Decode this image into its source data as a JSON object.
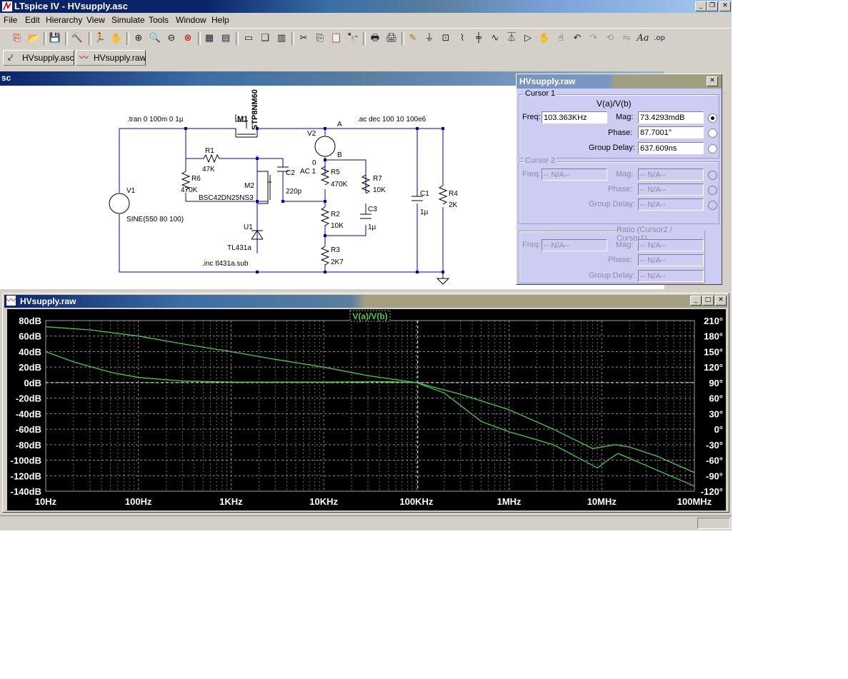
{
  "app": {
    "title": "LTspice IV - HVsupply.asc"
  },
  "menu": [
    "File",
    "Edit",
    "Hierarchy",
    "View",
    "Simulate",
    "Tools",
    "Window",
    "Help"
  ],
  "tabs": [
    {
      "label": "HVsupply.asc",
      "icon": "schematic-icon"
    },
    {
      "label": "HVsupply.raw",
      "icon": "waveform-icon"
    }
  ],
  "schematic": {
    "window_title": "sc",
    "directives": [
      ".tran 0 100m 0 1µ",
      ".ac dec 100 10 100e6",
      ".inc tl431a.sub"
    ],
    "components": {
      "m1_name": "M1",
      "m1_value": "STP8NM60",
      "m2_name": "M2",
      "m2_value": "BSC42DN25NS3",
      "r1_name": "R1",
      "r1_value": "47K",
      "r6_name": "R6",
      "r6_value": "470K",
      "c2_name": "C2",
      "c2_value": "220p",
      "v1_name": "V1",
      "v1_value": "SINE(550 80 100)",
      "v2_name": "V2",
      "v2_value": "AC 1",
      "v2_dc": "0",
      "r5_name": "R5",
      "r5_value": "470K",
      "r7_name": "R7",
      "r7_value": "10K",
      "c3_name": "C3",
      "c3_value": "1µ",
      "r2_name": "R2",
      "r2_value": "10K",
      "r3_name": "R3",
      "r3_value": "2K7",
      "u1_name": "U1",
      "u1_value": "TL431a",
      "c1_name": "C1",
      "c1_value": "1µ",
      "r4_name": "R4",
      "r4_value": "2K",
      "node_a": "A",
      "node_b": "B"
    }
  },
  "cursor_dialog": {
    "title": "HVsupply.raw",
    "cursor1": {
      "label": "Cursor 1",
      "trace": "V(a)/V(b)",
      "freq_label": "Freq:",
      "freq": "103.363KHz",
      "mag_label": "Mag:",
      "mag": "73.4293mdB",
      "phase_label": "Phase:",
      "phase": "87.7001°",
      "gd_label": "Group Delay:",
      "gd": "637.609ns"
    },
    "cursor2": {
      "label": "Cursor 2",
      "freq_label": "Freq:",
      "freq": "-- N/A--",
      "mag_label": "Mag:",
      "mag": "-- N/A--",
      "phase_label": "Phase:",
      "phase": "-- N/A--",
      "gd_label": "Group Delay:",
      "gd": "-- N/A--"
    },
    "ratio": {
      "label": "Ratio (Cursor2 / Cursor1)",
      "freq_label": "Freq:",
      "freq": "-- N/A--",
      "mag_label": "Mag:",
      "mag": "-- N/A--",
      "phase_label": "Phase:",
      "phase": "-- N/A--",
      "gd_label": "Group Delay:",
      "gd": "-- N/A--"
    }
  },
  "plot_window": {
    "title": "HVsupply.raw"
  },
  "chart_data": {
    "type": "line",
    "trace_label": "V(a)/V(b)",
    "x_scale": "log",
    "xlim": [
      10,
      100000000
    ],
    "x_ticks": [
      {
        "v": 10,
        "label": "10Hz"
      },
      {
        "v": 100,
        "label": "100Hz"
      },
      {
        "v": 1000,
        "label": "1KHz"
      },
      {
        "v": 10000,
        "label": "10KHz"
      },
      {
        "v": 100000,
        "label": "100KHz"
      },
      {
        "v": 1000000,
        "label": "1MHz"
      },
      {
        "v": 10000000,
        "label": "10MHz"
      },
      {
        "v": 100000000,
        "label": "100MHz"
      }
    ],
    "ylim_left": [
      -140,
      80
    ],
    "y_left_ticks": [
      {
        "v": 80,
        "label": "80dB"
      },
      {
        "v": 60,
        "label": "60dB"
      },
      {
        "v": 40,
        "label": "40dB"
      },
      {
        "v": 20,
        "label": "20dB"
      },
      {
        "v": 0,
        "label": "0dB"
      },
      {
        "v": -20,
        "label": "-20dB"
      },
      {
        "v": -40,
        "label": "-40dB"
      },
      {
        "v": -60,
        "label": "-60dB"
      },
      {
        "v": -80,
        "label": "-80dB"
      },
      {
        "v": -100,
        "label": "-100dB"
      },
      {
        "v": -120,
        "label": "-120dB"
      },
      {
        "v": -140,
        "label": "-140dB"
      }
    ],
    "ylim_right": [
      -120,
      210
    ],
    "y_right_ticks": [
      {
        "v": 210,
        "label": "210°"
      },
      {
        "v": 180,
        "label": "180°"
      },
      {
        "v": 150,
        "label": "150°"
      },
      {
        "v": 120,
        "label": "120°"
      },
      {
        "v": 90,
        "label": "90°"
      },
      {
        "v": 60,
        "label": "60°"
      },
      {
        "v": 30,
        "label": "30°"
      },
      {
        "v": 0,
        "label": "0°"
      },
      {
        "v": -30,
        "label": "-30°"
      },
      {
        "v": -60,
        "label": "-60°"
      },
      {
        "v": -90,
        "label": "-90°"
      },
      {
        "v": -120,
        "label": "-120°"
      }
    ],
    "grid": true,
    "cursor_x": 103363,
    "series": [
      {
        "name": "magnitude",
        "axis": "left",
        "color": "#4ec84e",
        "points": [
          [
            10,
            72
          ],
          [
            30,
            68
          ],
          [
            100,
            60
          ],
          [
            300,
            50
          ],
          [
            1000,
            40
          ],
          [
            3000,
            30
          ],
          [
            10000,
            20
          ],
          [
            30000,
            9
          ],
          [
            100000,
            0
          ],
          [
            300000,
            -15
          ],
          [
            1000000,
            -35
          ],
          [
            3000000,
            -60
          ],
          [
            8000000,
            -85
          ],
          [
            14000000,
            -80
          ],
          [
            20000000,
            -83
          ],
          [
            40000000,
            -95
          ],
          [
            100000000,
            -116
          ]
        ]
      },
      {
        "name": "phase",
        "axis": "right",
        "color": "#4ec84e",
        "points": [
          [
            10,
            150
          ],
          [
            20,
            130
          ],
          [
            50,
            110
          ],
          [
            100,
            100
          ],
          [
            300,
            93
          ],
          [
            1000,
            91
          ],
          [
            10000,
            91
          ],
          [
            50000,
            92
          ],
          [
            100000,
            90
          ],
          [
            200000,
            70
          ],
          [
            500000,
            15
          ],
          [
            1000000,
            -5
          ],
          [
            3000000,
            -30
          ],
          [
            9000000,
            -75
          ],
          [
            12000000,
            -58
          ],
          [
            15000000,
            -47
          ],
          [
            30000000,
            -70
          ],
          [
            100000000,
            -110
          ]
        ]
      }
    ]
  }
}
